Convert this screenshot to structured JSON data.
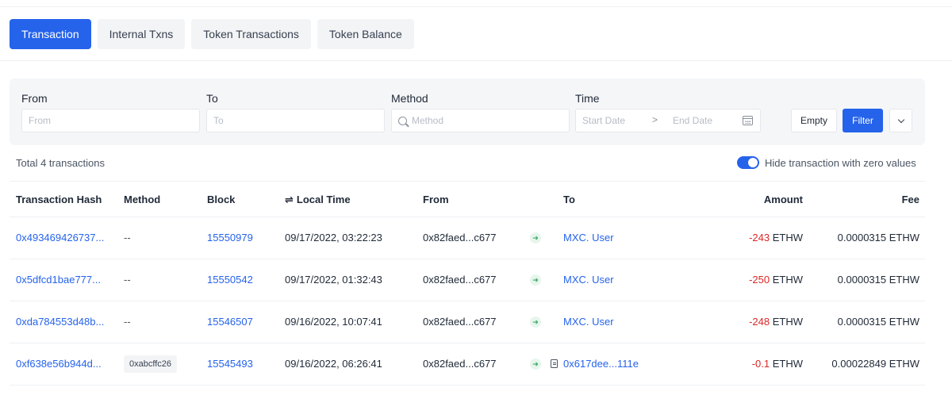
{
  "tabs": [
    {
      "label": "Transaction",
      "active": true
    },
    {
      "label": "Internal Txns",
      "active": false
    },
    {
      "label": "Token Transactions",
      "active": false
    },
    {
      "label": "Token Balance",
      "active": false
    }
  ],
  "filters": {
    "from": {
      "label": "From",
      "placeholder": "From"
    },
    "to": {
      "label": "To",
      "placeholder": "To"
    },
    "method": {
      "label": "Method",
      "placeholder": "Method",
      "icon": "search-icon"
    },
    "time": {
      "label": "Time",
      "start_placeholder": "Start Date",
      "separator": ">",
      "end_placeholder": "End Date",
      "icon": "calendar-icon"
    },
    "empty_button": "Empty",
    "filter_button": "Filter",
    "more_icon": "chevron-down-icon"
  },
  "summary": {
    "total_text": "Total 4 transactions",
    "hide_zero_label": "Hide transaction with zero values",
    "hide_zero_enabled": true
  },
  "table": {
    "columns": {
      "hash": "Transaction Hash",
      "method": "Method",
      "block": "Block",
      "time": "Local Time",
      "from": "From",
      "to": "To",
      "amount": "Amount",
      "fee": "Fee"
    },
    "rows": [
      {
        "hash": "0x493469426737...",
        "method": "--",
        "block": "15550979",
        "time": "09/17/2022, 03:22:23",
        "from": "0x82faed...c677",
        "to": "MXC. User",
        "amount": "-243",
        "unit": "ETHW",
        "fee": "0.0000315 ETHW"
      },
      {
        "hash": "0x5dfcd1bae777...",
        "method": "--",
        "block": "15550542",
        "time": "09/17/2022, 01:32:43",
        "from": "0x82faed...c677",
        "to": "MXC. User",
        "amount": "-250",
        "unit": "ETHW",
        "fee": "0.0000315 ETHW"
      },
      {
        "hash": "0xda784553d48b...",
        "method": "--",
        "block": "15546507",
        "time": "09/16/2022, 10:07:41",
        "from": "0x82faed...c677",
        "to": "MXC. User",
        "amount": "-248",
        "unit": "ETHW",
        "fee": "0.0000315 ETHW"
      },
      {
        "hash": "0xf638e56b944d...",
        "method": "0xabcffc26",
        "block": "15545493",
        "time": "09/16/2022, 06:26:41",
        "from": "0x82faed...c677",
        "to": "0x617dee...111e",
        "amount": "-0.1",
        "unit": "ETHW",
        "fee": "0.00022849 ETHW"
      }
    ]
  },
  "colors": {
    "accent": "#2563eb",
    "negative": "#dc2626",
    "in_arrow": "#3aa765"
  }
}
